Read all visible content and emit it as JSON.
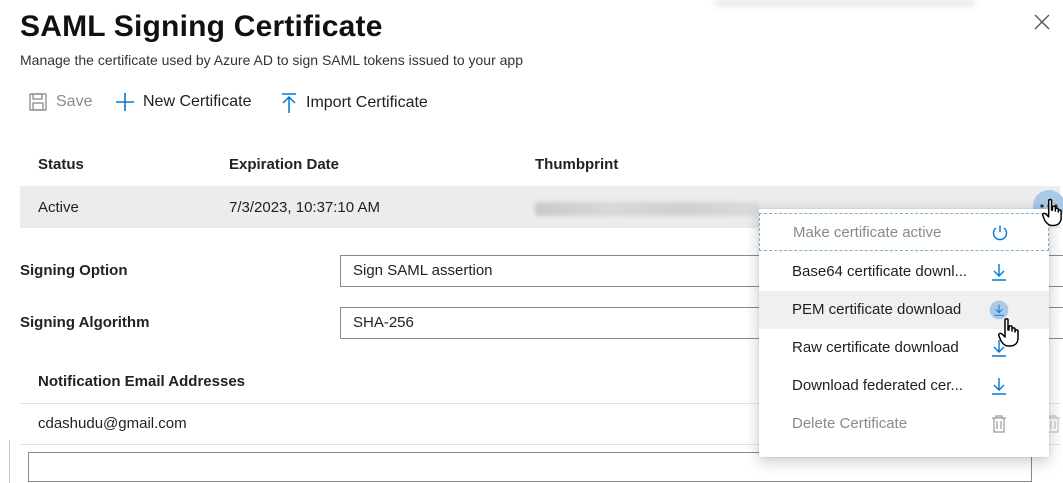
{
  "header": {
    "title": "SAML Signing Certificate",
    "subtitle": "Manage the certificate used by Azure AD to sign SAML tokens issued to your app",
    "close_glyph": "✕"
  },
  "toolbar": {
    "save_label": "Save",
    "new_label": "New Certificate",
    "import_label": "Import Certificate"
  },
  "table": {
    "columns": [
      "Status",
      "Expiration Date",
      "Thumbprint"
    ],
    "rows": [
      {
        "status": "Active",
        "expiration": "7/3/2023, 10:37:10 AM"
      }
    ]
  },
  "form": {
    "signing_option_label": "Signing Option",
    "signing_option_value": "Sign SAML assertion",
    "signing_algorithm_label": "Signing Algorithm",
    "signing_algorithm_value": "SHA-256"
  },
  "notifications": {
    "label": "Notification Email Addresses",
    "emails": [
      "cdashudu@gmail.com"
    ]
  },
  "context_menu": {
    "items": [
      {
        "label": "Make certificate active",
        "icon": "power-icon",
        "enabled": false
      },
      {
        "label": "Base64 certificate downl...",
        "icon": "download-icon",
        "enabled": true
      },
      {
        "label": "PEM certificate download",
        "icon": "download-icon",
        "enabled": true
      },
      {
        "label": "Raw certificate download",
        "icon": "download-icon",
        "enabled": true
      },
      {
        "label": "Download federated cer...",
        "icon": "download-icon",
        "enabled": true
      },
      {
        "label": "Delete Certificate",
        "icon": "trash-icon",
        "enabled": false
      }
    ]
  },
  "colors": {
    "accent": "#0078d4",
    "selected_row": "#ececec",
    "hover_circle": "#a9c9e6",
    "disabled_text": "#8a8a8a"
  }
}
